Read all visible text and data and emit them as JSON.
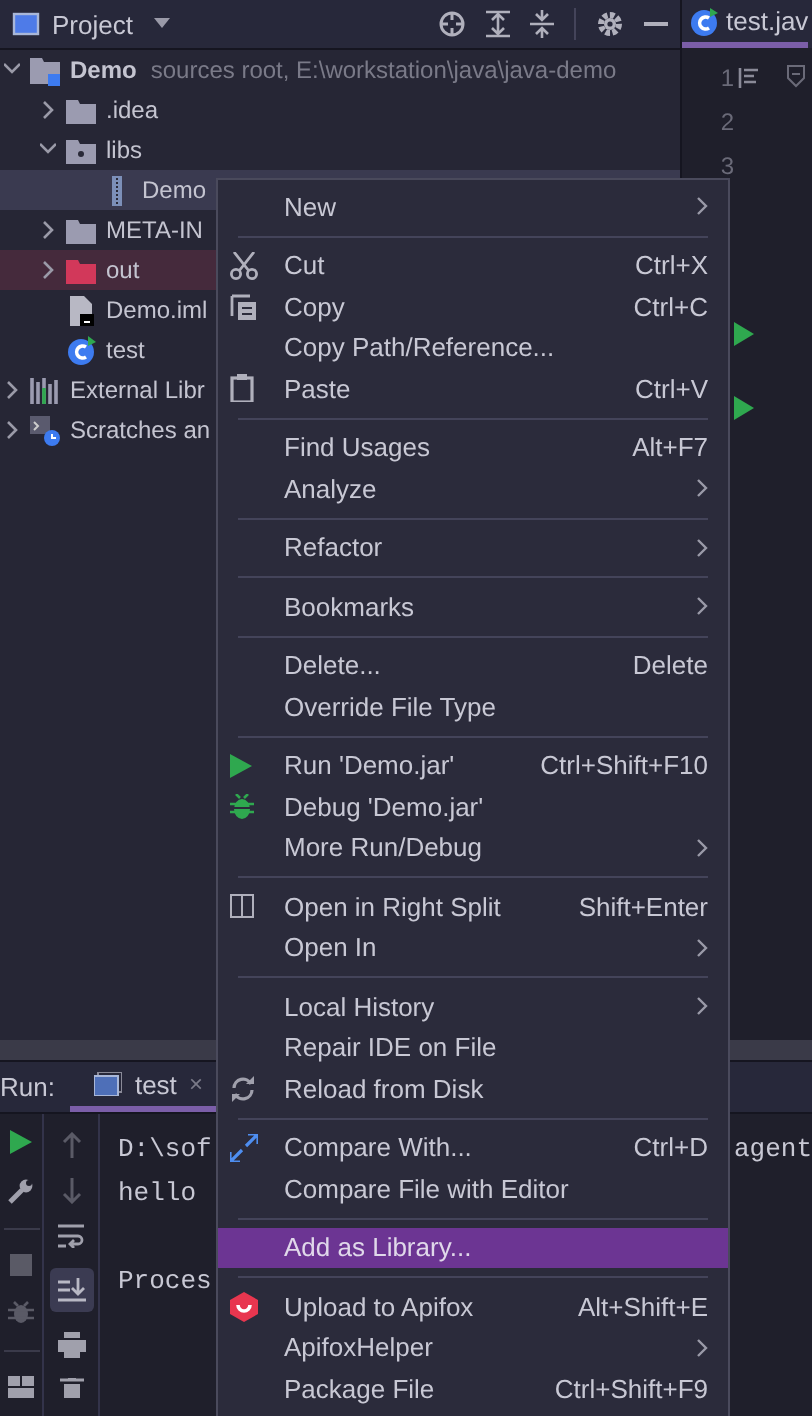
{
  "project_panel": {
    "title": "Project",
    "tree": [
      {
        "kind": "module",
        "label": "Demo",
        "note": "sources root,  E:\\workstation\\java\\java-demo",
        "expanded": true,
        "selected": false,
        "children": [
          {
            "kind": "folder",
            "label": ".idea",
            "expanded": false,
            "selected": false
          },
          {
            "kind": "libfolder",
            "label": "libs",
            "expanded": true,
            "selected": false,
            "children": [
              {
                "kind": "jar",
                "label": "Demo",
                "selected": true
              }
            ]
          },
          {
            "kind": "folder",
            "label": "META-IN",
            "expanded": false,
            "selected": false
          },
          {
            "kind": "excluded",
            "label": "out",
            "expanded": false,
            "selected": false
          },
          {
            "kind": "iml",
            "label": "Demo.iml",
            "selected": false
          },
          {
            "kind": "class",
            "label": "test",
            "selected": false
          }
        ]
      },
      {
        "kind": "libraries",
        "label": "External Libr",
        "expanded": false,
        "selected": false
      },
      {
        "kind": "scratches",
        "label": "Scratches an",
        "expanded": false,
        "selected": false
      }
    ]
  },
  "editor": {
    "tab": {
      "label": "test.jav",
      "selected": true
    },
    "line_numbers": [
      "1",
      "2",
      "3"
    ]
  },
  "run_panel": {
    "label": "Run:",
    "tabs": [
      {
        "label": "test",
        "selected": true,
        "close": "×"
      }
    ],
    "console": [
      {
        "kind": "line",
        "text": "D:\\sof",
        "tail": "agent"
      },
      {
        "kind": "line",
        "text": "hello"
      },
      {
        "kind": "blank"
      },
      {
        "kind": "line",
        "text": "Proces"
      }
    ]
  },
  "context_menu": [
    {
      "kind": "item",
      "label": "New",
      "submenu": true,
      "selected": false
    },
    {
      "kind": "separator"
    },
    {
      "kind": "item",
      "label": "Cut",
      "shortcut": "Ctrl+X",
      "submenu": false,
      "selected": false
    },
    {
      "kind": "item",
      "label": "Copy",
      "shortcut": "Ctrl+C",
      "submenu": false,
      "selected": false
    },
    {
      "kind": "item",
      "label": "Copy Path/Reference...",
      "submenu": false,
      "selected": false
    },
    {
      "kind": "item",
      "label": "Paste",
      "shortcut": "Ctrl+V",
      "submenu": false,
      "selected": false
    },
    {
      "kind": "separator"
    },
    {
      "kind": "item",
      "label": "Find Usages",
      "shortcut": "Alt+F7",
      "submenu": false,
      "selected": false
    },
    {
      "kind": "item",
      "label": "Analyze",
      "submenu": true,
      "selected": false
    },
    {
      "kind": "separator"
    },
    {
      "kind": "item",
      "label": "Refactor",
      "submenu": true,
      "selected": false
    },
    {
      "kind": "separator"
    },
    {
      "kind": "item",
      "label": "Bookmarks",
      "submenu": true,
      "selected": false
    },
    {
      "kind": "separator"
    },
    {
      "kind": "item",
      "label": "Delete...",
      "shortcut": "Delete",
      "submenu": false,
      "selected": false
    },
    {
      "kind": "item",
      "label": "Override File Type",
      "submenu": false,
      "selected": false
    },
    {
      "kind": "separator"
    },
    {
      "kind": "item",
      "label": "Run 'Demo.jar'",
      "shortcut": "Ctrl+Shift+F10",
      "submenu": false,
      "selected": false
    },
    {
      "kind": "item",
      "label": "Debug 'Demo.jar'",
      "submenu": false,
      "selected": false
    },
    {
      "kind": "item",
      "label": "More Run/Debug",
      "submenu": true,
      "selected": false
    },
    {
      "kind": "separator"
    },
    {
      "kind": "item",
      "label": "Open in Right Split",
      "shortcut": "Shift+Enter",
      "submenu": false,
      "selected": false
    },
    {
      "kind": "item",
      "label": "Open In",
      "submenu": true,
      "selected": false
    },
    {
      "kind": "separator"
    },
    {
      "kind": "item",
      "label": "Local History",
      "submenu": true,
      "selected": false
    },
    {
      "kind": "item",
      "label": "Repair IDE on File",
      "submenu": false,
      "selected": false
    },
    {
      "kind": "item",
      "label": "Reload from Disk",
      "submenu": false,
      "selected": false
    },
    {
      "kind": "separator"
    },
    {
      "kind": "item",
      "label": "Compare With...",
      "shortcut": "Ctrl+D",
      "submenu": false,
      "selected": false
    },
    {
      "kind": "item",
      "label": "Compare File with Editor",
      "submenu": false,
      "selected": false
    },
    {
      "kind": "separator"
    },
    {
      "kind": "item",
      "label": "Add as Library...",
      "submenu": false,
      "selected": true
    },
    {
      "kind": "separator"
    },
    {
      "kind": "item",
      "label": "Upload to Apifox",
      "shortcut": "Alt+Shift+E",
      "submenu": false,
      "selected": false
    },
    {
      "kind": "item",
      "label": "ApifoxHelper",
      "submenu": true,
      "selected": false
    },
    {
      "kind": "item",
      "label": "Package File",
      "shortcut": "Ctrl+Shift+F9",
      "submenu": false,
      "selected": false
    }
  ]
}
